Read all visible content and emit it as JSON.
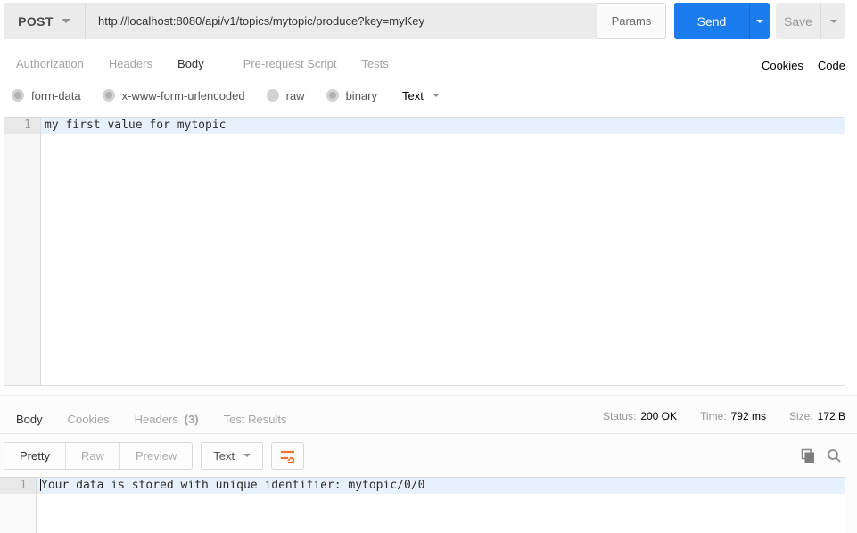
{
  "colors": {
    "accent_orange": "#F4702E",
    "send_blue": "#1B7CED",
    "status_green": "#2ABB7F"
  },
  "request_bar": {
    "method": "POST",
    "url": "http://localhost:8080/api/v1/topics/mytopic/produce?key=myKey",
    "params_label": "Params",
    "send_label": "Send",
    "save_label": "Save"
  },
  "request_tabs": {
    "items": [
      {
        "label": "Authorization"
      },
      {
        "label": "Headers"
      },
      {
        "label": "Body"
      },
      {
        "label": "Pre-request Script"
      },
      {
        "label": "Tests"
      }
    ],
    "cookies_label": "Cookies",
    "code_label": "Code"
  },
  "body_options": {
    "radios": [
      {
        "label": "form-data",
        "selected": false
      },
      {
        "label": "x-www-form-urlencoded",
        "selected": false
      },
      {
        "label": "raw",
        "selected": true
      },
      {
        "label": "binary",
        "selected": false
      }
    ],
    "type_label": "Text"
  },
  "request_editor": {
    "line_number": "1",
    "line_text": "my first value for mytopic"
  },
  "response": {
    "tabs": {
      "body": "Body",
      "cookies": "Cookies",
      "headers": "Headers",
      "headers_badge": "(3)",
      "test_results": "Test Results"
    },
    "meta": {
      "status_label": "Status:",
      "status_value": "200 OK",
      "time_label": "Time:",
      "time_value": "792 ms",
      "size_label": "Size:",
      "size_value": "172 B"
    },
    "view_tabs": {
      "pretty": "Pretty",
      "raw": "Raw",
      "preview": "Preview"
    },
    "type_label": "Text",
    "editor": {
      "line_number": "1",
      "line_text": "Your data is stored with unique identifier: mytopic/0/0"
    }
  }
}
